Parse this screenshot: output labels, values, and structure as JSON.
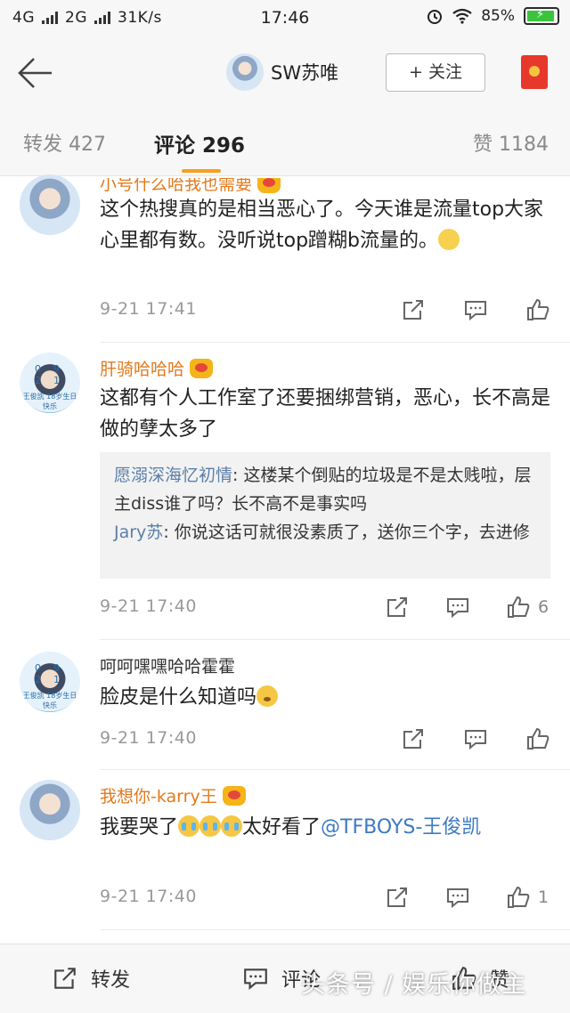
{
  "status_bar": {
    "network1": "4G",
    "network2": "2G",
    "speed": "31K/s",
    "time": "17:46",
    "battery": "85%",
    "battery_color": "#3bc43b"
  },
  "header": {
    "username": "SW苏唯",
    "follow_label": "+ 关注"
  },
  "tabs": {
    "repost": "转发 427",
    "comment": "评论 296",
    "like": "赞 1184",
    "accent": "#f8a01b"
  },
  "comments": [
    {
      "name": "小号什么哈我也需要",
      "text": "这个热搜真的是相当恶心了。今天谁是流量top大家心里都有数。没听说top蹭糊b流量的。",
      "time": "9-21 17:41",
      "likes": ""
    },
    {
      "name": "肝骑哈哈哈",
      "avatar_badge_num": "09  21",
      "avatar_badge_sub": "王俊凯 18岁生日快乐",
      "text": "这都有个人工作室了还要捆绑营销，恶心，长不高是做的孽太多了",
      "replies": [
        {
          "user": "愿溺深海忆初情",
          "text": "这楼某个倒贴的垃圾是不是太贱啦，层主diss谁了吗？长不高不是事实吗"
        },
        {
          "user": "Jary苏",
          "text": "你说这话可就很没素质了，送你三个字，去进修"
        }
      ],
      "time": "9-21 17:40",
      "likes": "6"
    },
    {
      "name": "呵呵嘿嘿哈哈霍霍",
      "avatar_badge_num": "09  21",
      "avatar_badge_sub": "王俊凯 18岁生日快乐",
      "text": "脸皮是什么知道吗",
      "time": "9-21 17:40",
      "likes": ""
    },
    {
      "name": "我想你-karry王",
      "text": "我要哭了",
      "text_after": "太好看了",
      "mention": "@TFBOYS-王俊凯",
      "time": "9-21 17:40",
      "likes": "1"
    }
  ],
  "bottom_bar": {
    "repost": "转发",
    "comment": "评论",
    "like": "赞",
    "watermark": "头条号 / 娱乐你做主"
  },
  "icons": [
    "back-arrow-icon",
    "share-icon",
    "comment-icon",
    "like-icon",
    "crown-icon",
    "red-packet-icon",
    "wifi-icon",
    "alarm-icon"
  ]
}
